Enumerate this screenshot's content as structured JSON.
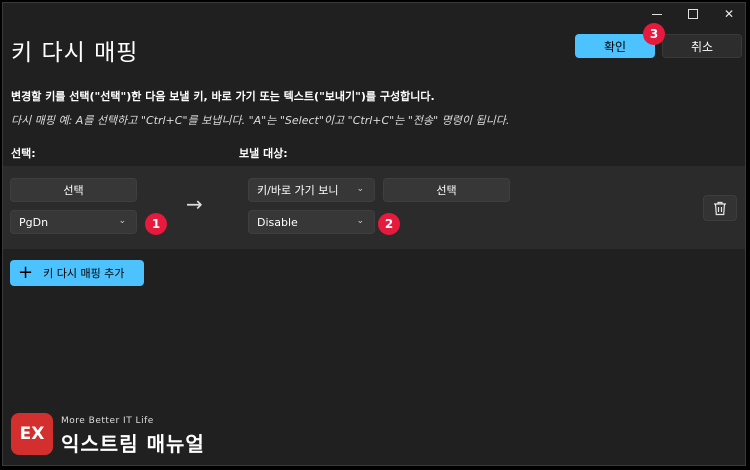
{
  "window": {
    "title": "키 다시 매핑",
    "minimize_label": "—",
    "maximize_label": "",
    "close_label": "✕"
  },
  "header": {
    "confirm_label": "확인",
    "cancel_label": "취소"
  },
  "description": {
    "line1": "변경할 키를 선택(\"선택\")한 다음 보낼 키, 바로 가기 또는 텍스트(\"보내기\")를 구성합니다.",
    "line2": "다시 매핑 예: A를 선택하고 \"Ctrl+C\"를 보냅니다. \"A\"는 \"Select\"이고 \"Ctrl+C\"는 \"전송\" 명령이 됩니다."
  },
  "columns": {
    "select_label": "선택:",
    "target_label": "보낼 대상:"
  },
  "mapping_row": {
    "select_button": "선택",
    "source_key": "PgDn",
    "target_type": "키/바로 가기 보니",
    "target_select_button": "선택",
    "target_key": "Disable",
    "arrow": "→"
  },
  "add_button": {
    "plus": "+",
    "label": "키 다시 매핑 추가"
  },
  "badges": {
    "b1": "1",
    "b2": "2",
    "b3": "3"
  },
  "watermark": {
    "logo_text": "EX",
    "tagline": "More Better IT Life",
    "name": "익스트림 매뉴얼"
  },
  "icons": {
    "trash": "trash-icon",
    "chevron": "chevron-down-icon",
    "arrow": "arrow-right-icon"
  },
  "colors": {
    "accent": "#4cc2ff",
    "badge": "#e51a3d",
    "background": "#202020"
  }
}
